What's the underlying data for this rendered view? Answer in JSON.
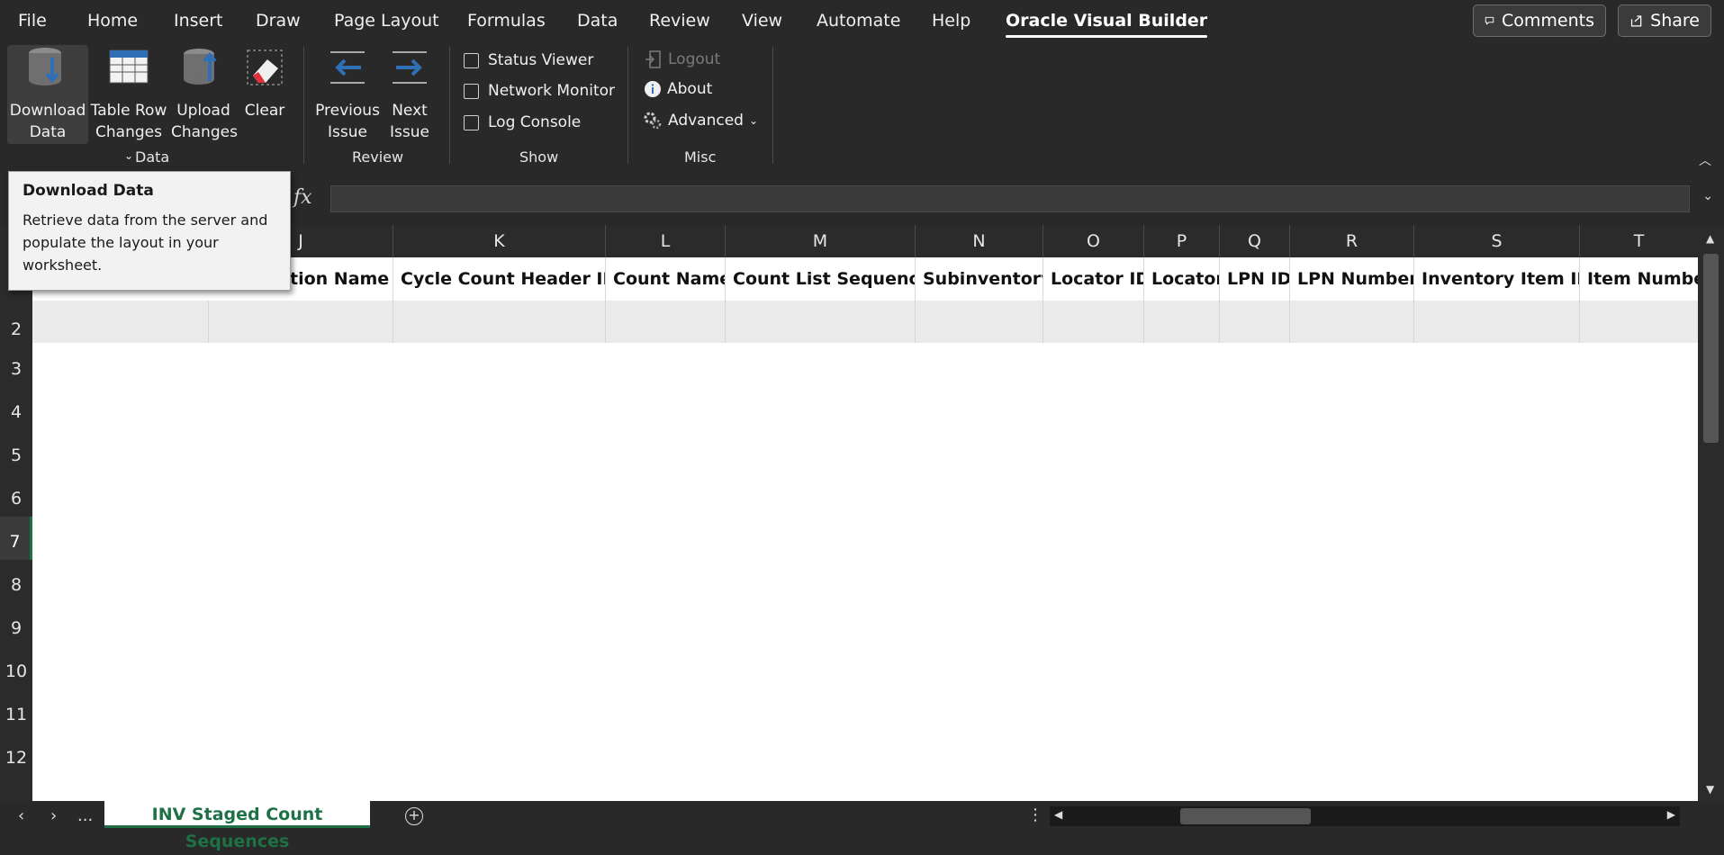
{
  "menu": {
    "tabs": [
      "File",
      "Home",
      "Insert",
      "Draw",
      "Page Layout",
      "Formulas",
      "Data",
      "Review",
      "View",
      "Automate",
      "Help",
      "Oracle Visual Builder"
    ],
    "active_tab": "Oracle Visual Builder",
    "comments_label": "Comments",
    "share_label": "Share"
  },
  "ribbon": {
    "data_group": {
      "label": "Data",
      "download_line1": "Download",
      "download_line2": "Data",
      "table_row_line1": "Table Row",
      "table_row_line2": "Changes",
      "upload_line1": "Upload",
      "upload_line2": "Changes",
      "clear": "Clear"
    },
    "review_group": {
      "label": "Review",
      "prev_line1": "Previous",
      "prev_line2": "Issue",
      "next_line1": "Next",
      "next_line2": "Issue"
    },
    "show_group": {
      "label": "Show",
      "status_viewer": "Status Viewer",
      "network_monitor": "Network Monitor",
      "log_console": "Log Console"
    },
    "misc_group": {
      "label": "Misc",
      "logout": "Logout",
      "about": "About",
      "advanced": "Advanced"
    }
  },
  "formula_bar": {
    "fx": "fx",
    "value": ""
  },
  "grid": {
    "column_letters": [
      "J",
      "K",
      "L",
      "M",
      "N",
      "O",
      "P",
      "Q",
      "R",
      "S",
      "T"
    ],
    "header_cells": [
      "tion Name",
      "Cycle Count Header ID",
      "Count Name",
      "Count List Sequence",
      "Subinventory",
      "Locator ID",
      "Locator",
      "LPN ID",
      "LPN Number",
      "Inventory Item ID",
      "Item Number"
    ],
    "row_numbers": [
      "2",
      "3",
      "4",
      "5",
      "6",
      "7",
      "8",
      "9",
      "10",
      "11",
      "12"
    ],
    "selected_row": "7"
  },
  "sheet": {
    "tab_label": "INV Staged Count Sequences",
    "ellipsis": "..."
  },
  "tooltip": {
    "title": "Download Data",
    "body": "Retrieve data from the server and populate the layout in your worksheet."
  },
  "colors": {
    "accent_green": "#1e7145",
    "ribbon_bg": "#292929"
  }
}
